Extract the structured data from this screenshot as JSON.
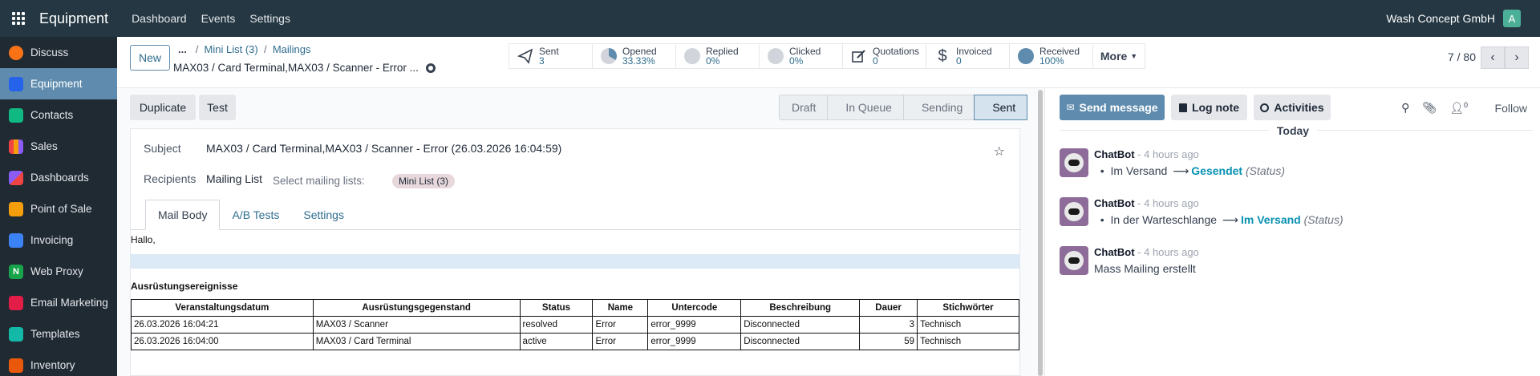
{
  "topbar": {
    "app_name": "Equipment",
    "nav": [
      "Dashboard",
      "Events",
      "Settings"
    ],
    "company": "Wash Concept GmbH",
    "user_initial": "A"
  },
  "sidebar": {
    "items": [
      {
        "label": "Discuss",
        "color": "#f97316",
        "active": false
      },
      {
        "label": "Equipment",
        "color": "#2563eb",
        "active": true
      },
      {
        "label": "Contacts",
        "color": "#10b981",
        "active": false
      },
      {
        "label": "Sales",
        "color": "#ef4444",
        "active": false
      },
      {
        "label": "Dashboards",
        "color": "#8b5cf6",
        "active": false
      },
      {
        "label": "Point of Sale",
        "color": "#f59e0b",
        "active": false
      },
      {
        "label": "Invoicing",
        "color": "#3b82f6",
        "active": false
      },
      {
        "label": "Web Proxy",
        "color": "#16a34a",
        "active": false
      },
      {
        "label": "Email Marketing",
        "color": "#e11d48",
        "active": false
      },
      {
        "label": "Templates",
        "color": "#14b8a6",
        "active": false
      },
      {
        "label": "Inventory",
        "color": "#ea580c",
        "active": false
      }
    ]
  },
  "control_panel": {
    "new_label": "New",
    "breadcrumb_dots": "...",
    "breadcrumb_1": "Mini List (3)",
    "breadcrumb_2": "Mailings",
    "record_title": "MAX03 / Card Terminal,MAX03 / Scanner - Error ...",
    "stats": [
      {
        "label": "Sent",
        "value": "3",
        "icon": "paper-plane-icon"
      },
      {
        "label": "Opened",
        "value": "33.33%",
        "icon": "pie-icon"
      },
      {
        "label": "Replied",
        "value": "0%",
        "icon": "pie-icon"
      },
      {
        "label": "Clicked",
        "value": "0%",
        "icon": "pie-icon"
      },
      {
        "label": "Quotations",
        "value": "0",
        "icon": "edit-icon"
      },
      {
        "label": "Invoiced",
        "value": "0",
        "icon": "dollar-icon"
      },
      {
        "label": "Received",
        "value": "100%",
        "icon": "pie-icon"
      }
    ],
    "more_label": "More",
    "pager": "7 / 80"
  },
  "form": {
    "duplicate_label": "Duplicate",
    "test_label": "Test",
    "statuses": [
      "Draft",
      "In Queue",
      "Sending",
      "Sent"
    ],
    "active_status": "Sent",
    "subject_label": "Subject",
    "subject_value": "MAX03 / Card Terminal,MAX03 / Scanner - Error (26.03.2026 16:04:59)",
    "recipients_label": "Recipients",
    "recipients_value": "Mailing List",
    "select_lists_label": "Select mailing lists:",
    "list_tag": "Mini List (3)",
    "tabs": [
      "Mail Body",
      "A/B Tests",
      "Settings"
    ],
    "body_greeting": "Hallo,",
    "body_heading": "Ausrüstungsereignisse",
    "table_headers": [
      "Veranstaltungsdatum",
      "Ausrüstungsgegenstand",
      "Status",
      "Name",
      "Untercode",
      "Beschreibung",
      "Dauer",
      "Stichwörter"
    ],
    "table_rows": [
      [
        "26.03.2026 16:04:21",
        "MAX03 / Scanner",
        "resolved",
        "Error",
        "error_9999",
        "Disconnected",
        "3",
        "Technisch"
      ],
      [
        "26.03.2026 16:04:00",
        "MAX03 / Card Terminal",
        "active",
        "Error",
        "error_9999",
        "Disconnected",
        "59",
        "Technisch"
      ]
    ]
  },
  "chatter": {
    "send_message_label": "Send message",
    "log_note_label": "Log note",
    "activities_label": "Activities",
    "follower_count": "0",
    "follow_label": "Follow",
    "day_label": "Today",
    "messages": [
      {
        "author": "ChatBot",
        "time": "- 4 hours ago",
        "old": "Im Versand",
        "new": "Gesendet",
        "field": "(Status)"
      },
      {
        "author": "ChatBot",
        "time": "- 4 hours ago",
        "old": "In der Warteschlange",
        "new": "Im Versand",
        "field": "(Status)"
      },
      {
        "author": "ChatBot",
        "time": "- 4 hours ago",
        "text": "Mass Mailing erstellt"
      }
    ]
  }
}
